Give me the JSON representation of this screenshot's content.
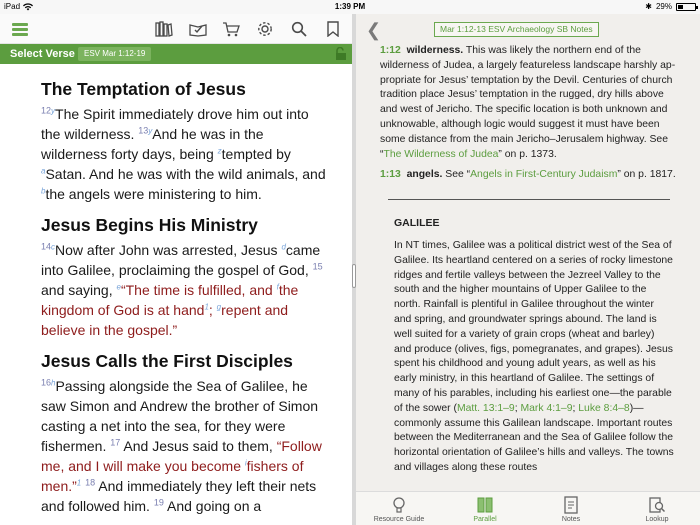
{
  "status_bar": {
    "device": "iPad",
    "time": "1:39 PM",
    "battery": "29%"
  },
  "left": {
    "select_verse_label": "Select Verse",
    "reference": "ESV Mar 1:12-19",
    "sections": [
      {
        "heading": "The Temptation of Jesus"
      },
      {
        "heading": "Jesus Begins His Ministry"
      },
      {
        "heading": "Jesus Calls the First Disciples"
      }
    ],
    "verse_text": {
      "v12n": "12",
      "v12f": "y",
      "v12": "The Spirit immediately drove him out into the wilderness.",
      "v13n": "13",
      "v13f": "y",
      "v13a": "And he was in the wilderness forty days, being ",
      "v13f2": "z",
      "v13b": "tempted by ",
      "v13f3": "a",
      "v13c": "Satan. And he was with the wild animals, and ",
      "v13f4": "b",
      "v13d": "the angels were ministering to him.",
      "v14n": "14",
      "v14f": "c",
      "v14a": "Now after John was arrested, Jesus ",
      "v14f2": "d",
      "v14b": "came into Galilee, proclaiming the gospel of God,",
      "v15n": "15",
      "v15a": "and saying, ",
      "v15f": "e",
      "v15b": "“The time is fulfilled, and ",
      "v15f2": "f",
      "v15c": "the kingdom of God is at hand",
      "v15f3": "1",
      "v15d": "; ",
      "v15f4": "g",
      "v15e": "repent and believe in the gospel.”",
      "v16n": "16",
      "v16f": "h",
      "v16a": "Passing alongside the Sea of Galilee, he saw Simon and Andrew the brother of Si­mon casting a net into the sea, for they were fishermen.",
      "v17n": "17",
      "v17a": "And Jesus said to them, ",
      "v17b": "“Fol­low me, and I will make you become ",
      "v17f": "i",
      "v17c": "fishers of men.”",
      "v17f2": "1",
      "v18n": "18",
      "v18a": "And immediately they left their nets and followed him.",
      "v19n": "19",
      "v19a": "And going on a"
    }
  },
  "right": {
    "title": "Mar 1:12-13 ESV Archaeology SB Notes",
    "note1_ref": "1:12",
    "note1_term": "wilderness.",
    "note1_text": "This was likely the northern end of the wilderness of Judea, a largely featureless landscape harshly ap­propriate for Jesus’ temptation by the Devil. Centuries of church tradition place Jesus’ temptation in the rugged, dry hills above and west of Jericho. The specific location is both un­known and unknowable, although logic would suggest it must have been some distance from the main Jericho–Jerusalem highway. See “",
    "note1_link": "The Wilderness of Judea",
    "note1_tail": "” on p. 1373.",
    "note2_ref": "1:13",
    "note2_term": "angels.",
    "note2_pre": "See “",
    "note2_link": "Angels in First-Century Judaism",
    "note2_tail": "” on p. 1817.",
    "box_title": "GALILEE",
    "box_text": "In NT times, Galilee was a political district west of the Sea of Galilee. Its heartland centered on a series of rocky lime­stone ridges and fertile valleys between the Jezreel Valley to the south and the higher mountains of Upper Galilee to the north. Rainfall is plentiful in Galilee throughout the winter and spring, and groundwater springs abound. The land is well suited for a variety of grain crops (wheat and barley) and produce (olives, figs, pomegranates, and grapes). Jesus spent his childhood and young adult years, as well as his early ministry, in this heartland of Galilee. The settings of many of his parables, including his earliest one—the parable of the sower (",
    "box_link1": "Matt. 13:1–9",
    "box_sep1": "; ",
    "box_link2": "Mark 4:1–9",
    "box_sep2": ";",
    "box_link3": "Luke 8:4–8",
    "box_text2": ")—commonly assume this Galilean landscape. Important routes between the Mediterranean and the Sea of Galilee follow the horizontal orientation of Galilee’s hills and valleys. The towns and villages along these routes",
    "tabs": [
      {
        "label": "Resource Guide",
        "icon": "lightbulb-icon"
      },
      {
        "label": "Parallel",
        "icon": "parallel-icon"
      },
      {
        "label": "Notes",
        "icon": "notes-icon"
      },
      {
        "label": "Lookup",
        "icon": "lookup-icon"
      }
    ]
  },
  "colors": {
    "accent_green": "#5c9d3f",
    "words_of_christ_red": "#8e1c1c",
    "verse_number": "#7a7fb0"
  }
}
